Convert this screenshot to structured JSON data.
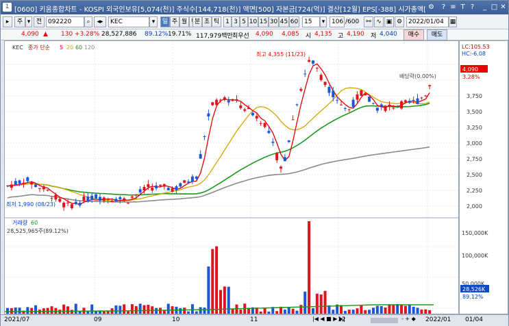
{
  "window": {
    "title": "[0600] 키움종합차트 - KOSPI 외국인보유[5,074(천)] 주식수[144,718(천)] 액면[500] 자본금[724(억)] 결산[12월] EPS[-388] 시가총액[",
    "number": "1",
    "controls": [
      "⚙",
      "?",
      "≡",
      "T",
      "?",
      "_",
      "□",
      "✕"
    ]
  },
  "toolbar": {
    "stock_code": "092220",
    "stock_name": "KEC",
    "view_labels": [
      "주",
      "전"
    ],
    "periods": [
      "일",
      "주",
      "월",
      "년",
      "분",
      "초",
      "틱"
    ],
    "intervals": [
      "1",
      "3",
      "5",
      "10",
      "15",
      "30",
      "45",
      "60"
    ],
    "interval_sel": "15",
    "count": "106",
    "count_total": "/600",
    "date": "2022/01/04"
  },
  "quote": {
    "price": "4,090",
    "change": "130",
    "change_pct": "+3.28%",
    "volume": "28,527,886",
    "ratio1": "89.12%",
    "ratio2": "19.71%",
    "amount": "117,979백만",
    "pref_label": "최우선",
    "pref_ask": "4,090",
    "pref_bid": "4,085",
    "open_label": "시",
    "open": "4,135",
    "high_label": "고",
    "high": "4,190",
    "low_label": "저",
    "low": "4,040",
    "buy": "매수",
    "sell": "매도"
  },
  "legend": {
    "name": "KEC",
    "ma_label": "종가 단순",
    "ma": [
      "5",
      "20",
      "60",
      "120"
    ]
  },
  "annotations": {
    "high": "최고 4,355 (11/23)",
    "low": "최저 1,990 (08/23)",
    "dividend": "배당락(0.00%)"
  },
  "volume_panel": {
    "label": "거래량",
    "ma": "60",
    "value": "28,525,965주(89.12%)"
  },
  "axis": {
    "lc": "LC:105.53",
    "hc": "HC:-6.08",
    "price_tag": "4,090",
    "pct_tag": "3.28%",
    "vol_tag": "28,526K",
    "vol_pct": "89.12%",
    "price_ticks": [
      "3,750",
      "3,500",
      "3,250",
      "3,000",
      "2,750",
      "2,500",
      "2,250",
      "2,000"
    ],
    "vol_ticks": [
      "150,000K",
      "100,000K",
      "50,000K"
    ]
  },
  "x_ticks": [
    "2021/07",
    "09",
    "10",
    "11",
    "12",
    "2022/01",
    "01/04"
  ],
  "chart_data": {
    "type": "candlestick",
    "series": [
      "price",
      "volume"
    ],
    "ylim": [
      1900,
      4400
    ],
    "price_anchor_points": [
      {
        "t": "2021/07",
        "close": 2300
      },
      {
        "t": "08/23",
        "close": 1990
      },
      {
        "t": "09",
        "close": 2100
      },
      {
        "t": "10",
        "close": 2300
      },
      {
        "t": "10 late",
        "close": 3600
      },
      {
        "t": "11",
        "close": 2550
      },
      {
        "t": "11/23",
        "close": 4355
      },
      {
        "t": "12",
        "close": 3500
      },
      {
        "t": "01/04",
        "close": 4090
      }
    ]
  }
}
